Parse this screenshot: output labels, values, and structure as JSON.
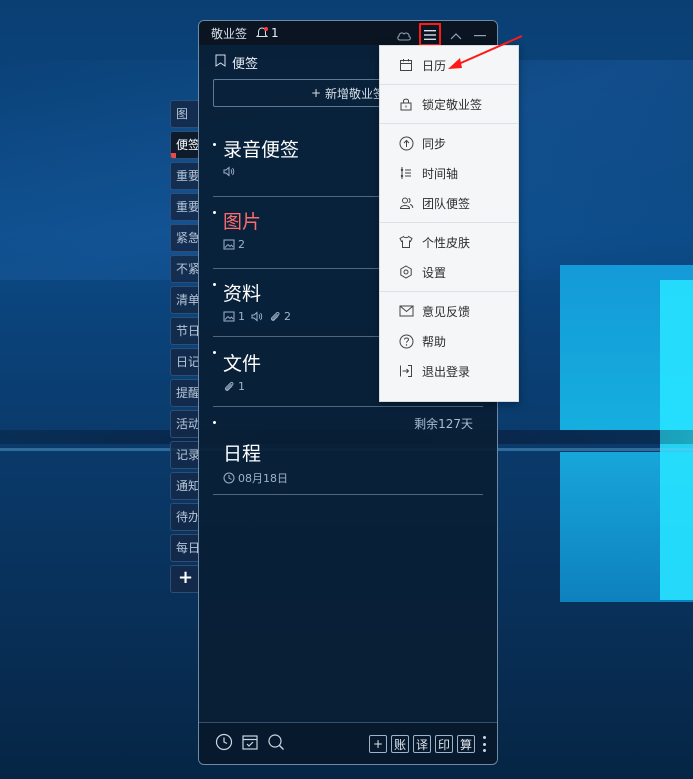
{
  "app": {
    "title": "敬业签",
    "notification_count": "1"
  },
  "panel": {
    "section_title": "便签",
    "new_note_label": "新增敬业签",
    "remaining_days": "剩余127天"
  },
  "side_tabs": [
    {
      "label": "图"
    },
    {
      "label": "便签"
    },
    {
      "label": "重要"
    },
    {
      "label": "重要"
    },
    {
      "label": "紧急"
    },
    {
      "label": "不紧"
    },
    {
      "label": "清单"
    },
    {
      "label": "节日"
    },
    {
      "label": "日记"
    },
    {
      "label": "提醒"
    },
    {
      "label": "活动"
    },
    {
      "label": "记录"
    },
    {
      "label": "通知"
    },
    {
      "label": "待办"
    },
    {
      "label": "每日"
    }
  ],
  "add_tab_label": "+",
  "notes": [
    {
      "title": "录音便签",
      "meta": []
    },
    {
      "title": "图片",
      "meta": [
        "2"
      ]
    },
    {
      "title": "资料",
      "meta": [
        "1",
        "2"
      ]
    },
    {
      "title": "文件",
      "meta": [
        "1"
      ]
    },
    {
      "title": "日程",
      "meta": [
        "08月18日"
      ]
    }
  ],
  "footer": {
    "buttons": [
      "+",
      "账",
      "译",
      "印",
      "算"
    ]
  },
  "menu": {
    "calendar": "日历",
    "lock": "锁定敬业签",
    "sync": "同步",
    "timeline": "时间轴",
    "team": "团队便签",
    "skin": "个性皮肤",
    "settings": "设置",
    "feedback": "意见反馈",
    "help": "帮助",
    "logout": "退出登录"
  },
  "colors": {
    "highlight_box": "#ff1a1a",
    "red_title": "#ff6b6b",
    "panel_bg": "#091e34"
  }
}
